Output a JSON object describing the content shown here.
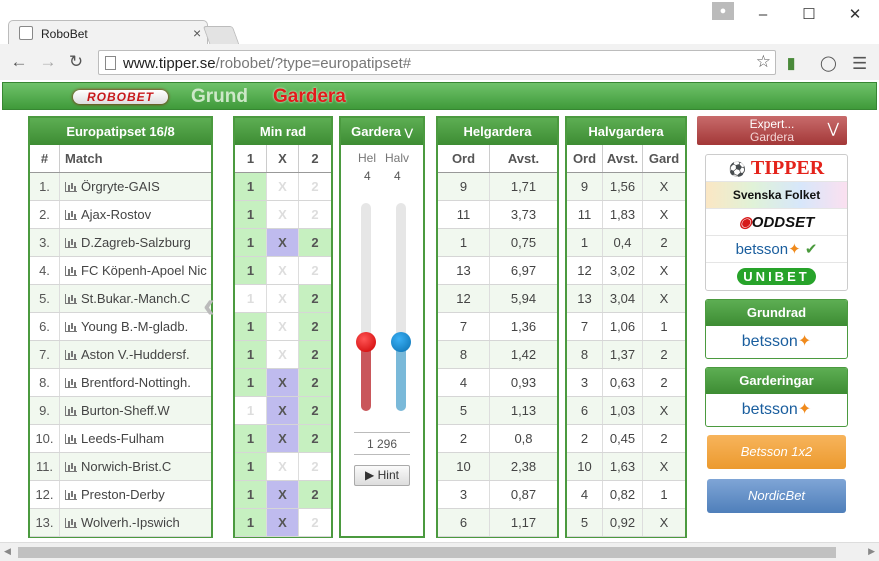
{
  "browser": {
    "tab_title": "RoboBet",
    "url_host": "www.tipper.se",
    "url_path": "/robobet/?type=europatipset#"
  },
  "nav": {
    "logo": "ROBOBET",
    "grund": "Grund",
    "gardera": "Gardera"
  },
  "matches_panel": {
    "title": "Europatipset 16/8",
    "col_num": "#",
    "col_match": "Match",
    "rows": [
      {
        "n": "1.",
        "match": "Örgryte-GAIS"
      },
      {
        "n": "2.",
        "match": "Ajax-Rostov"
      },
      {
        "n": "3.",
        "match": "D.Zagreb-Salzburg"
      },
      {
        "n": "4.",
        "match": "FC Köpenh-Apoel Nic"
      },
      {
        "n": "5.",
        "match": "St.Bukar.-Manch.C"
      },
      {
        "n": "6.",
        "match": "Young B.-M-gladb."
      },
      {
        "n": "7.",
        "match": "Aston V.-Huddersf."
      },
      {
        "n": "8.",
        "match": "Brentford-Nottingh."
      },
      {
        "n": "9.",
        "match": "Burton-Sheff.W"
      },
      {
        "n": "10.",
        "match": "Leeds-Fulham"
      },
      {
        "n": "11.",
        "match": "Norwich-Brist.C"
      },
      {
        "n": "12.",
        "match": "Preston-Derby"
      },
      {
        "n": "13.",
        "match": "Wolverh.-Ipswich"
      }
    ]
  },
  "minrad_panel": {
    "title": "Min rad",
    "cols": [
      "1",
      "X",
      "2"
    ],
    "rows": [
      [
        "1",
        "X",
        "2"
      ],
      [
        "1",
        "X",
        "2"
      ],
      [
        "1",
        "X",
        "2"
      ],
      [
        "1",
        "X",
        "2"
      ],
      [
        "1",
        "X",
        "2"
      ],
      [
        "1",
        "X",
        "2"
      ],
      [
        "1",
        "X",
        "2"
      ],
      [
        "1",
        "X",
        "2"
      ],
      [
        "1",
        "X",
        "2"
      ],
      [
        "1",
        "X",
        "2"
      ],
      [
        "1",
        "X",
        "2"
      ],
      [
        "1",
        "X",
        "2"
      ],
      [
        "1",
        "X",
        "2"
      ]
    ],
    "selected": [
      [
        1,
        0,
        0
      ],
      [
        1,
        0,
        0
      ],
      [
        1,
        1,
        1
      ],
      [
        1,
        0,
        0
      ],
      [
        0,
        0,
        1
      ],
      [
        1,
        0,
        1
      ],
      [
        1,
        0,
        1
      ],
      [
        1,
        1,
        1
      ],
      [
        0,
        1,
        1
      ],
      [
        1,
        1,
        1
      ],
      [
        1,
        0,
        0
      ],
      [
        1,
        1,
        1
      ],
      [
        1,
        1,
        0
      ]
    ]
  },
  "gardera_panel": {
    "title": "Gardera",
    "hel_label": "Hel",
    "halv_label": "Halv",
    "hel_value": "4",
    "halv_value": "4",
    "rows_count": "1 296",
    "hint_label": "Hint",
    "hel_slider_level": 0.33,
    "halv_slider_level": 0.33
  },
  "helgardera_panel": {
    "title": "Helgardera",
    "col_ord": "Ord",
    "col_avst": "Avst.",
    "rows": [
      [
        "9",
        "1,71"
      ],
      [
        "11",
        "3,73"
      ],
      [
        "1",
        "0,75"
      ],
      [
        "13",
        "6,97"
      ],
      [
        "12",
        "5,94"
      ],
      [
        "7",
        "1,36"
      ],
      [
        "8",
        "1,42"
      ],
      [
        "4",
        "0,93"
      ],
      [
        "5",
        "1,13"
      ],
      [
        "2",
        "0,8"
      ],
      [
        "10",
        "2,38"
      ],
      [
        "3",
        "0,87"
      ],
      [
        "6",
        "1,17"
      ]
    ]
  },
  "halvgardera_panel": {
    "title": "Halvgardera",
    "col_ord": "Ord",
    "col_avst": "Avst.",
    "col_gard": "Gard",
    "rows": [
      [
        "9",
        "1,56",
        "X"
      ],
      [
        "11",
        "1,83",
        "X"
      ],
      [
        "1",
        "0,4",
        "2"
      ],
      [
        "12",
        "3,02",
        "X"
      ],
      [
        "13",
        "3,04",
        "X"
      ],
      [
        "7",
        "1,06",
        "1"
      ],
      [
        "8",
        "1,37",
        "2"
      ],
      [
        "3",
        "0,63",
        "2"
      ],
      [
        "6",
        "1,03",
        "X"
      ],
      [
        "2",
        "0,45",
        "2"
      ],
      [
        "10",
        "1,63",
        "X"
      ],
      [
        "4",
        "0,82",
        "1"
      ],
      [
        "5",
        "0,92",
        "X"
      ]
    ]
  },
  "right_panel": {
    "expert_title": "Expert...",
    "expert_sub": "Gardera",
    "books": [
      "TIPPER",
      "Svenska Folket",
      "ODDSET",
      "betsson",
      "UNIBET"
    ],
    "check": "✔",
    "grundrad_title": "Grundrad",
    "grundrad_book": "betsson",
    "garderingar_title": "Garderingar",
    "garderingar_book": "betsson",
    "btn_1x2": "Betsson 1x2",
    "btn_nordic": "NordicBet"
  }
}
